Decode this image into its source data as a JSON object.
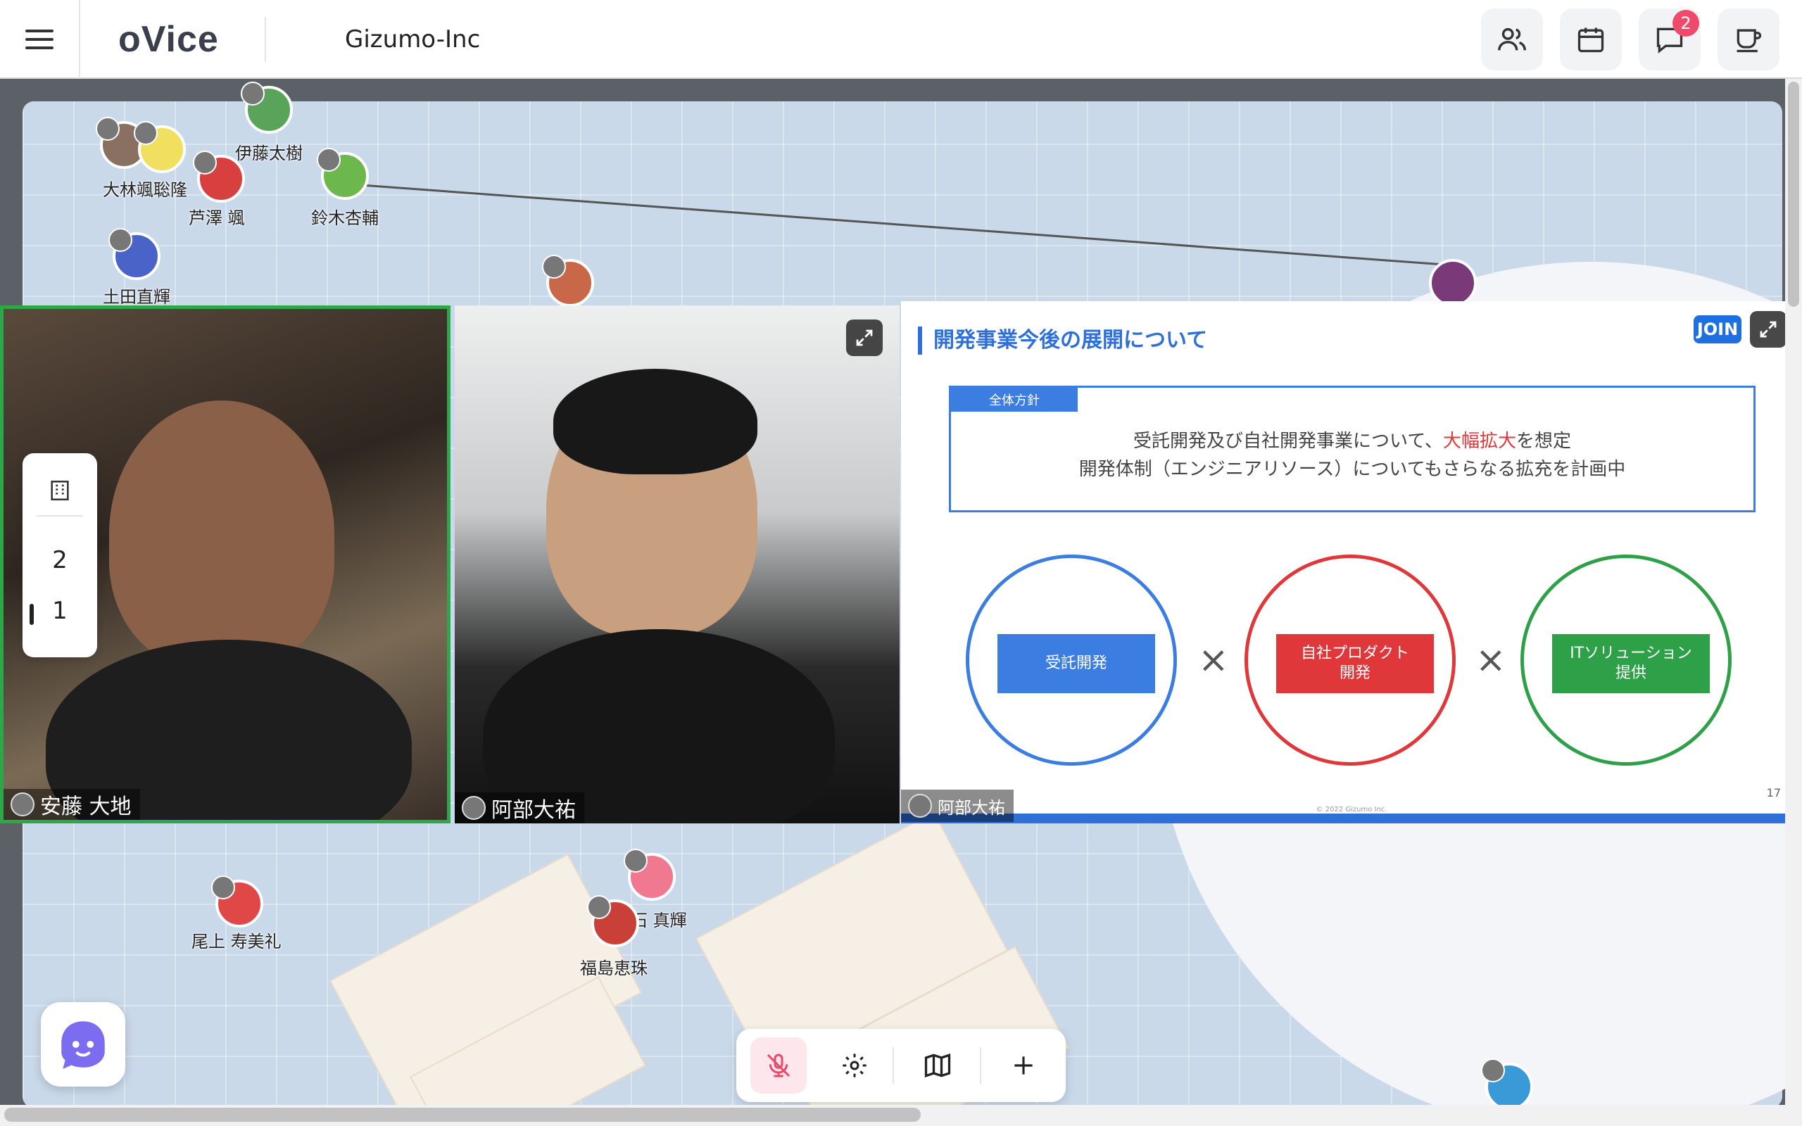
{
  "app": {
    "logo": "oVice",
    "organization": "Gizumo-Inc"
  },
  "header": {
    "menu_icon": "hamburger-icon",
    "icons": [
      {
        "name": "members-icon"
      },
      {
        "name": "calendar-icon"
      },
      {
        "name": "chat-icon",
        "badge": "2"
      },
      {
        "name": "coffee-icon"
      }
    ],
    "badge_color": "#f04a6a"
  },
  "map": {
    "users": [
      {
        "name": "伊藤太樹"
      },
      {
        "name": "大林颯聡隆"
      },
      {
        "name": "芦澤 颯"
      },
      {
        "name": "鈴木杏輔"
      },
      {
        "name": "土田直輝"
      },
      {
        "name": "尾上 寿美礼"
      },
      {
        "name": "赤石 真輝"
      },
      {
        "name": "福島恵珠"
      }
    ]
  },
  "videos": [
    {
      "label": "安藤 大地",
      "active_border_color": "#2ca84a"
    },
    {
      "label": "阿部大祐"
    }
  ],
  "slide": {
    "title": "開発事業今後の展開について",
    "join_label": "JOIN",
    "policy_tag": "全体方針",
    "policy_line1_a": "受託開発及び自社開発事業について、",
    "policy_line1_highlight": "大幅拡大",
    "policy_line1_b": "を想定",
    "policy_line2": "開発体制（エンジニアリソース）についてもさらなる拡充を計画中",
    "circles": [
      {
        "label": "受託開発",
        "color": "#3b7de0"
      },
      {
        "label": "自社プロダクト\n開発",
        "color": "#e0373a"
      },
      {
        "label": "ITソリューション\n提供",
        "color": "#2ea048"
      }
    ],
    "times_symbol": "×",
    "presenter": "阿部大祐",
    "copyright": "© 2022 Gizumo Inc.",
    "page_number": "17"
  },
  "floor_selector": {
    "items": [
      "2",
      "1"
    ],
    "current": "1",
    "icon": "building-icon"
  },
  "toolbar": {
    "items": [
      {
        "name": "mic-off-icon"
      },
      {
        "name": "settings-icon"
      },
      {
        "name": "map-icon"
      },
      {
        "name": "add-icon"
      }
    ]
  }
}
